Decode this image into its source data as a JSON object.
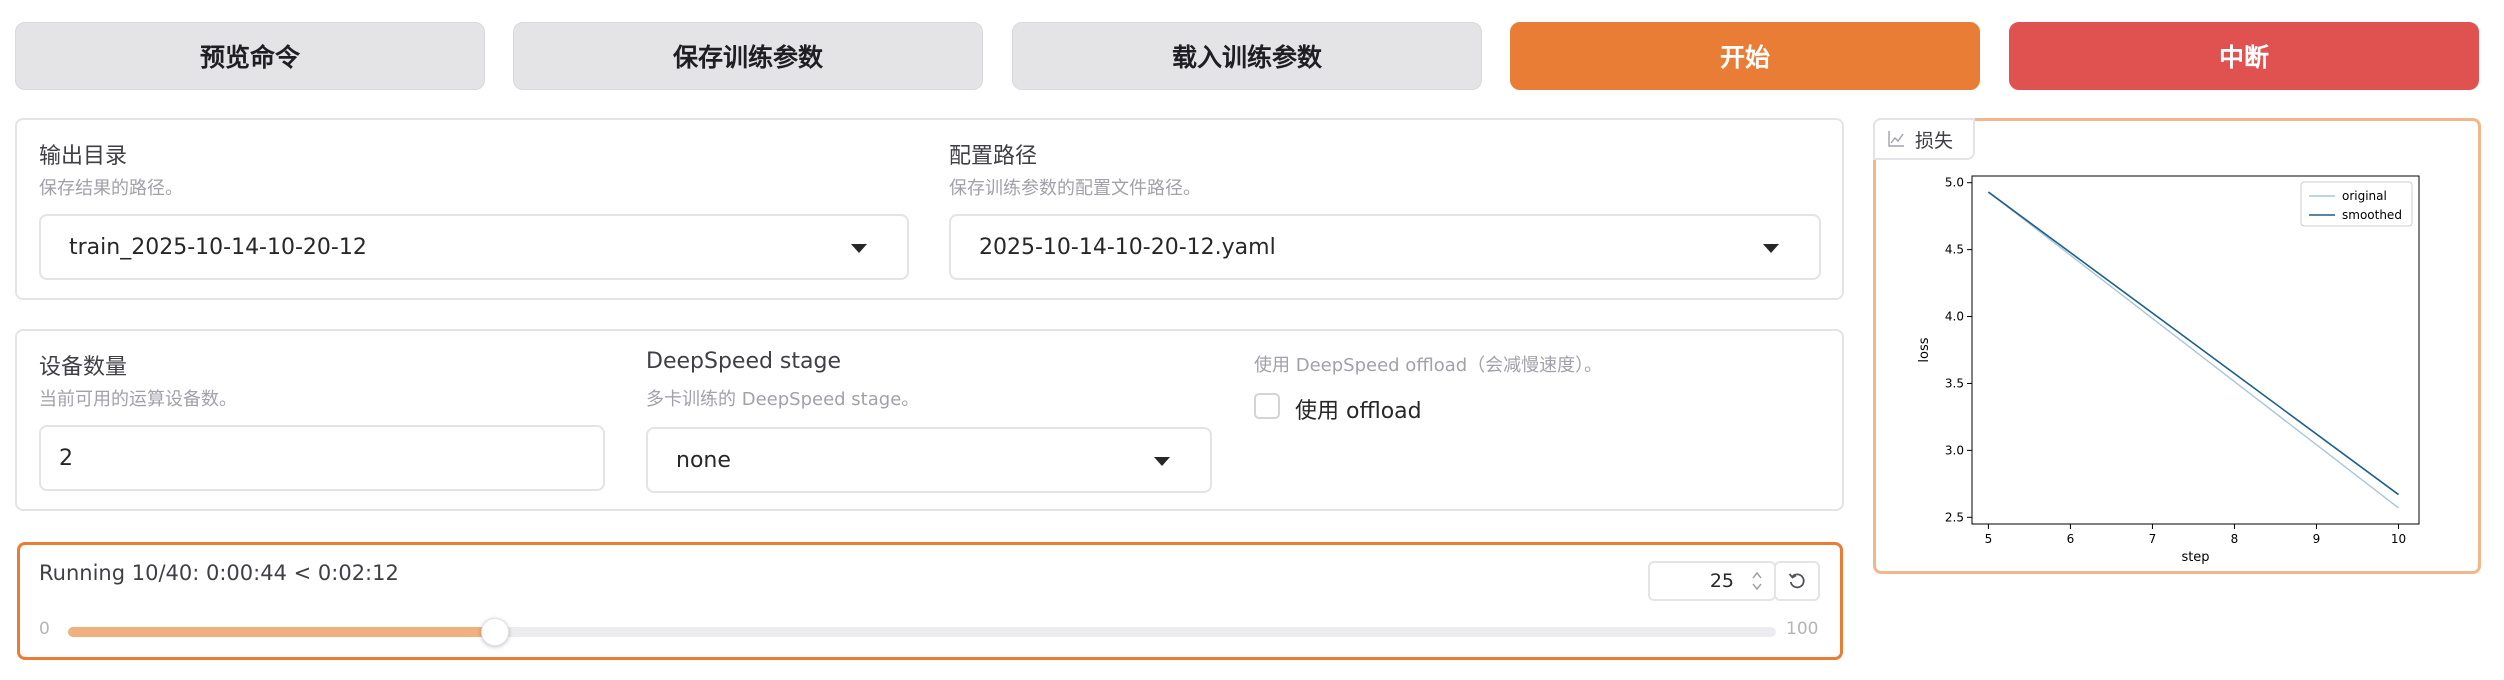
{
  "toolbar": {
    "preview_label": "预览命令",
    "save_params_label": "保存训练参数",
    "load_params_label": "载入训练参数",
    "start_label": "开始",
    "abort_label": "中断"
  },
  "output_dir": {
    "label": "输出目录",
    "info": "保存结果的路径。",
    "value": "train_2025-10-14-10-20-12"
  },
  "config_path": {
    "label": "配置路径",
    "info": "保存训练参数的配置文件路径。",
    "value": "2025-10-14-10-20-12.yaml"
  },
  "device_count": {
    "label": "设备数量",
    "info": "当前可用的运算设备数。",
    "value": "2"
  },
  "ds_stage": {
    "label": "DeepSpeed stage",
    "info": "多卡训练的 DeepSpeed stage。",
    "value": "none"
  },
  "ds_offload": {
    "info": "使用 DeepSpeed offload（会减慢速度）。",
    "label": "使用 offload",
    "checked": false
  },
  "progress": {
    "status": "Running 10/40: 0:00:44 < 0:02:12",
    "min_label": "0",
    "max_label": "100",
    "value": 25,
    "value_text": "25"
  },
  "plot": {
    "tab_label": "损失",
    "icon": "chart-icon"
  },
  "colors": {
    "accent": "#e97d35",
    "danger": "#e05250",
    "original_line": "#a9c6dc",
    "smoothed_line": "#1f5f8b"
  },
  "chart_data": {
    "type": "line",
    "title": "",
    "xlabel": "step",
    "ylabel": "loss",
    "xlim": [
      4.8,
      10.25
    ],
    "ylim": [
      2.45,
      5.05
    ],
    "xticks": [
      5,
      6,
      7,
      8,
      9,
      10
    ],
    "yticks": [
      2.5,
      3.0,
      3.5,
      4.0,
      4.5,
      5.0
    ],
    "ytick_labels": [
      "2.5",
      "3.0",
      "3.5",
      "4.0",
      "4.5",
      "5.0"
    ],
    "legend_position": "top-right",
    "series": [
      {
        "name": "original",
        "x": [
          5,
          10
        ],
        "y": [
          4.93,
          2.57
        ]
      },
      {
        "name": "smoothed",
        "x": [
          5,
          10
        ],
        "y": [
          4.93,
          2.67
        ]
      }
    ]
  }
}
